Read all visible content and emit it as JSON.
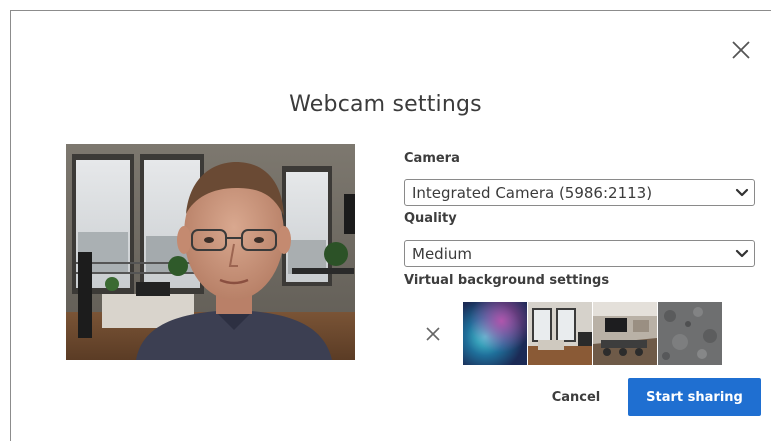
{
  "dialog": {
    "title": "Webcam settings",
    "close_icon": "close-icon"
  },
  "camera": {
    "label": "Camera",
    "selected": "Integrated Camera (5986:2113)"
  },
  "quality": {
    "label": "Quality",
    "selected": "Medium"
  },
  "virtual_background": {
    "label": "Virtual background settings",
    "none_icon": "close-icon",
    "options": [
      "blur-aurora",
      "office-room",
      "conference-room",
      "concrete-texture"
    ]
  },
  "actions": {
    "cancel_label": "Cancel",
    "start_label": "Start sharing"
  },
  "colors": {
    "primary_button": "#1f6fd1",
    "text": "#3b3b3b",
    "border": "#8a8a8a"
  }
}
